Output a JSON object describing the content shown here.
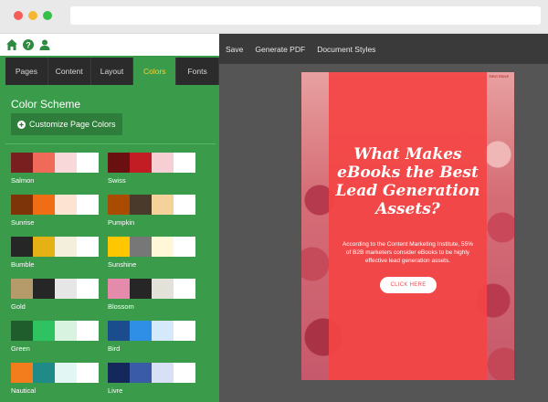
{
  "sidebar": {
    "icons": [
      "home-icon",
      "help-icon",
      "user-icon"
    ],
    "tabs": [
      {
        "label": "Pages",
        "active": false
      },
      {
        "label": "Content",
        "active": false
      },
      {
        "label": "Layout",
        "active": false
      },
      {
        "label": "Colors",
        "active": true
      },
      {
        "label": "Fonts",
        "active": false
      }
    ],
    "section_title": "Color Scheme",
    "customize_label": "Customize Page Colors",
    "schemes": [
      {
        "name": "Salmon",
        "colors": [
          "#7a1f1f",
          "#f06a5a",
          "#f8d8d8",
          "#ffffff"
        ]
      },
      {
        "name": "Swiss",
        "colors": [
          "#6a1010",
          "#c21d24",
          "#f5cfd4",
          "#ffffff"
        ]
      },
      {
        "name": "Sunrise",
        "colors": [
          "#7d3408",
          "#ef6d14",
          "#fde3d2",
          "#ffffff"
        ]
      },
      {
        "name": "Pumpkin",
        "colors": [
          "#a94b00",
          "#4a3a2c",
          "#f5d29a",
          "#ffffff"
        ]
      },
      {
        "name": "Bumble",
        "colors": [
          "#262626",
          "#e6b114",
          "#f4efdc",
          "#ffffff"
        ]
      },
      {
        "name": "Sunshine",
        "colors": [
          "#ffc700",
          "#777777",
          "#fff7d8",
          "#ffffff"
        ]
      },
      {
        "name": "Gold",
        "colors": [
          "#b59a6a",
          "#262626",
          "#e6e6e6",
          "#ffffff"
        ]
      },
      {
        "name": "Blossom",
        "colors": [
          "#e48aaa",
          "#262626",
          "#e2e2da",
          "#ffffff"
        ]
      },
      {
        "name": "Green",
        "colors": [
          "#1f5d2c",
          "#2fc260",
          "#d8f3df",
          "#ffffff"
        ]
      },
      {
        "name": "Bird",
        "colors": [
          "#1b4d8c",
          "#2f8fe6",
          "#d6e9fb",
          "#ffffff"
        ]
      },
      {
        "name": "Nautical",
        "colors": [
          "#f37c1c",
          "#1f8a86",
          "#e2f7f4",
          "#ffffff"
        ]
      },
      {
        "name": "Livre",
        "colors": [
          "#15285c",
          "#3a5ca8",
          "#d8e0f5",
          "#ffffff"
        ]
      }
    ]
  },
  "editor": {
    "toolbar": {
      "save": "Save",
      "generate_pdf": "Generate PDF",
      "document_styles": "Document Styles"
    },
    "page": {
      "corner_label": "Next Move",
      "heading_lines": [
        "What Makes",
        "eBooks the Best",
        "Lead Generation",
        "Assets?"
      ],
      "subtext": "According to the Content Marketing Institute, 55% of B2B marketers consider eBooks to be highly effective lead generation assets.",
      "cta": "CLICK HERE"
    }
  },
  "colors": {
    "sidebar_green": "#3a9b4a",
    "tab_bar": "#2b2b2b",
    "active_tab_text": "#f3d23a",
    "editor_bg": "#555555",
    "page_overlay_red": "#f44444"
  }
}
